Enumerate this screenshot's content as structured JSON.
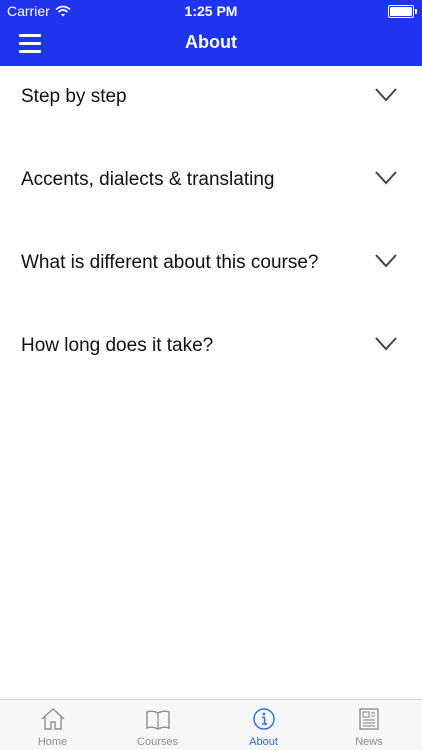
{
  "status_bar": {
    "carrier": "Carrier",
    "time": "1:25 PM"
  },
  "header": {
    "title": "About"
  },
  "sections": [
    {
      "label": "Step by step"
    },
    {
      "label": "Accents, dialects & translating"
    },
    {
      "label": "What is different about this course?"
    },
    {
      "label": "How long does it take?"
    }
  ],
  "tabbar": {
    "active": "About",
    "items": [
      {
        "label": "Home",
        "icon": "home-icon"
      },
      {
        "label": "Courses",
        "icon": "book-icon"
      },
      {
        "label": "About",
        "icon": "info-icon"
      },
      {
        "label": "News",
        "icon": "newspaper-icon"
      }
    ]
  },
  "colors": {
    "header_bg": "#2033ee",
    "active_tab": "#2a6fe0",
    "inactive_tab": "#8e8e93"
  }
}
